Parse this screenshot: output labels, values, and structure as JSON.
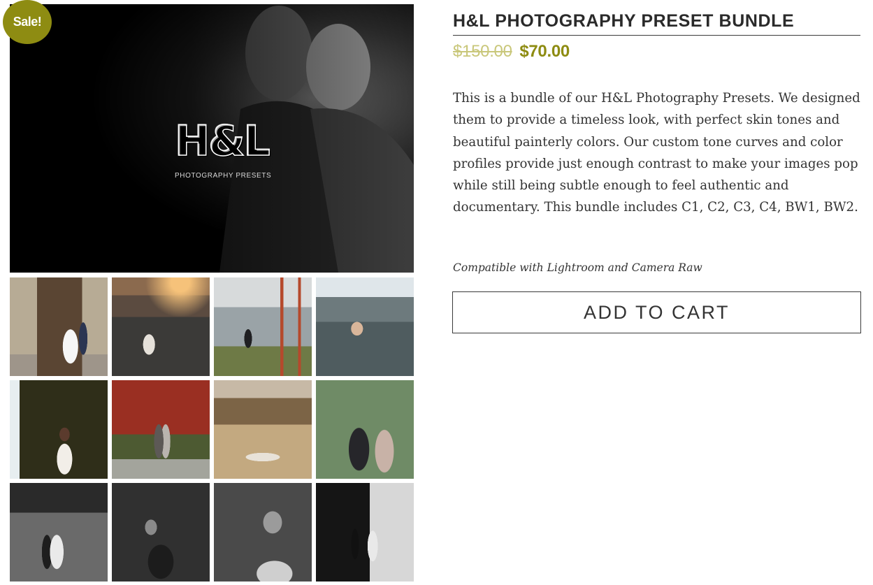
{
  "gallery": {
    "sale_badge": "Sale!",
    "main_logo_mark": "H&L",
    "main_logo_caption": "PHOTOGRAPHY PRESETS",
    "thumbnail_count": 12
  },
  "product": {
    "title": "H&L PHOTOGRAPHY PRESET BUNDLE",
    "price_original": "$150.00",
    "price_sale": "$70.00",
    "description": "This is a bundle of our H&L Photography Presets. We designed them to provide a timeless look, with perfect skin tones and beautiful painterly colors. Our custom tone curves and color profiles provide just enough contrast to make your images pop while still being subtle enough to feel authentic and documentary. This bundle includes C1, C2, C3, C4, BW1, BW2.",
    "compatibility": "Compatible with Lightroom and Camera Raw",
    "add_to_cart_label": "ADD TO CART"
  },
  "colors": {
    "accent": "#8e8c12",
    "accent_light": "#c9c77a",
    "text": "#333333"
  }
}
